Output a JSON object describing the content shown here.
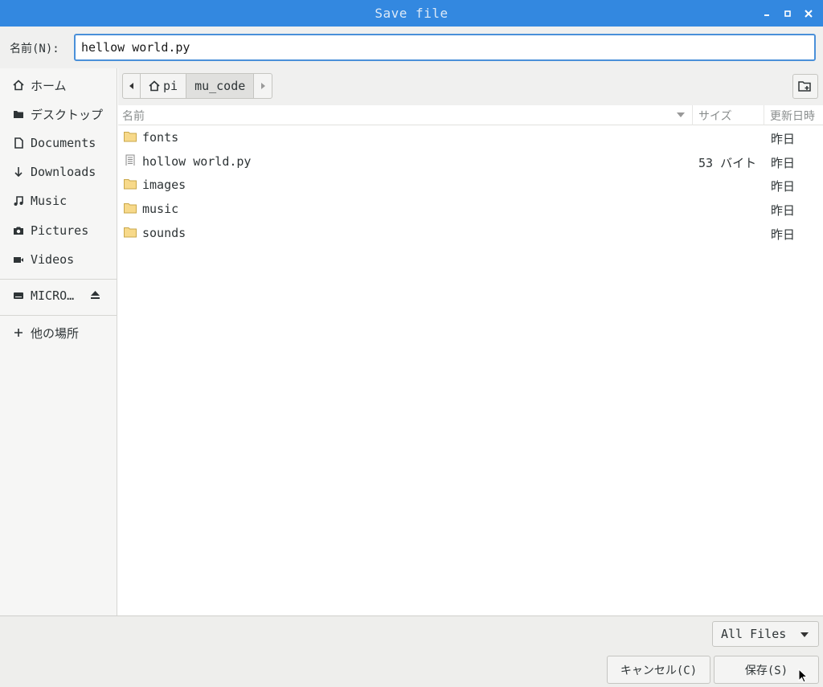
{
  "window": {
    "title": "Save file"
  },
  "namebar": {
    "label": "名前(N):",
    "value": "hellow world.py"
  },
  "sidebar": {
    "items": [
      {
        "label": "ホーム",
        "icon": "home-icon"
      },
      {
        "label": "デスクトップ",
        "icon": "desktop-icon"
      },
      {
        "label": "Documents",
        "icon": "document-icon"
      },
      {
        "label": "Downloads",
        "icon": "download-icon"
      },
      {
        "label": "Music",
        "icon": "music-icon"
      },
      {
        "label": "Pictures",
        "icon": "camera-icon"
      },
      {
        "label": "Videos",
        "icon": "video-icon"
      }
    ],
    "device": {
      "label": "MICRO…",
      "icon": "drive-icon"
    },
    "other": {
      "label": "他の場所",
      "icon": "plus-icon"
    }
  },
  "pathbar": {
    "home": "pi",
    "current": "mu_code"
  },
  "list": {
    "columns": {
      "name": "名前",
      "size": "サイズ",
      "date": "更新日時"
    },
    "rows": [
      {
        "name": "fonts",
        "type": "folder",
        "size": "",
        "date": "昨日"
      },
      {
        "name": "hollow world.py",
        "type": "file",
        "size": "53 バイト",
        "date": "昨日"
      },
      {
        "name": "images",
        "type": "folder",
        "size": "",
        "date": "昨日"
      },
      {
        "name": "music",
        "type": "folder",
        "size": "",
        "date": "昨日"
      },
      {
        "name": "sounds",
        "type": "folder",
        "size": "",
        "date": "昨日"
      }
    ]
  },
  "footer": {
    "filter": "All Files",
    "cancel": "キャンセル(C)",
    "save": "保存(S)"
  },
  "colors": {
    "titlebar": "#3388e0",
    "accent": "#4a90d9",
    "folder": "#f7d98a"
  }
}
